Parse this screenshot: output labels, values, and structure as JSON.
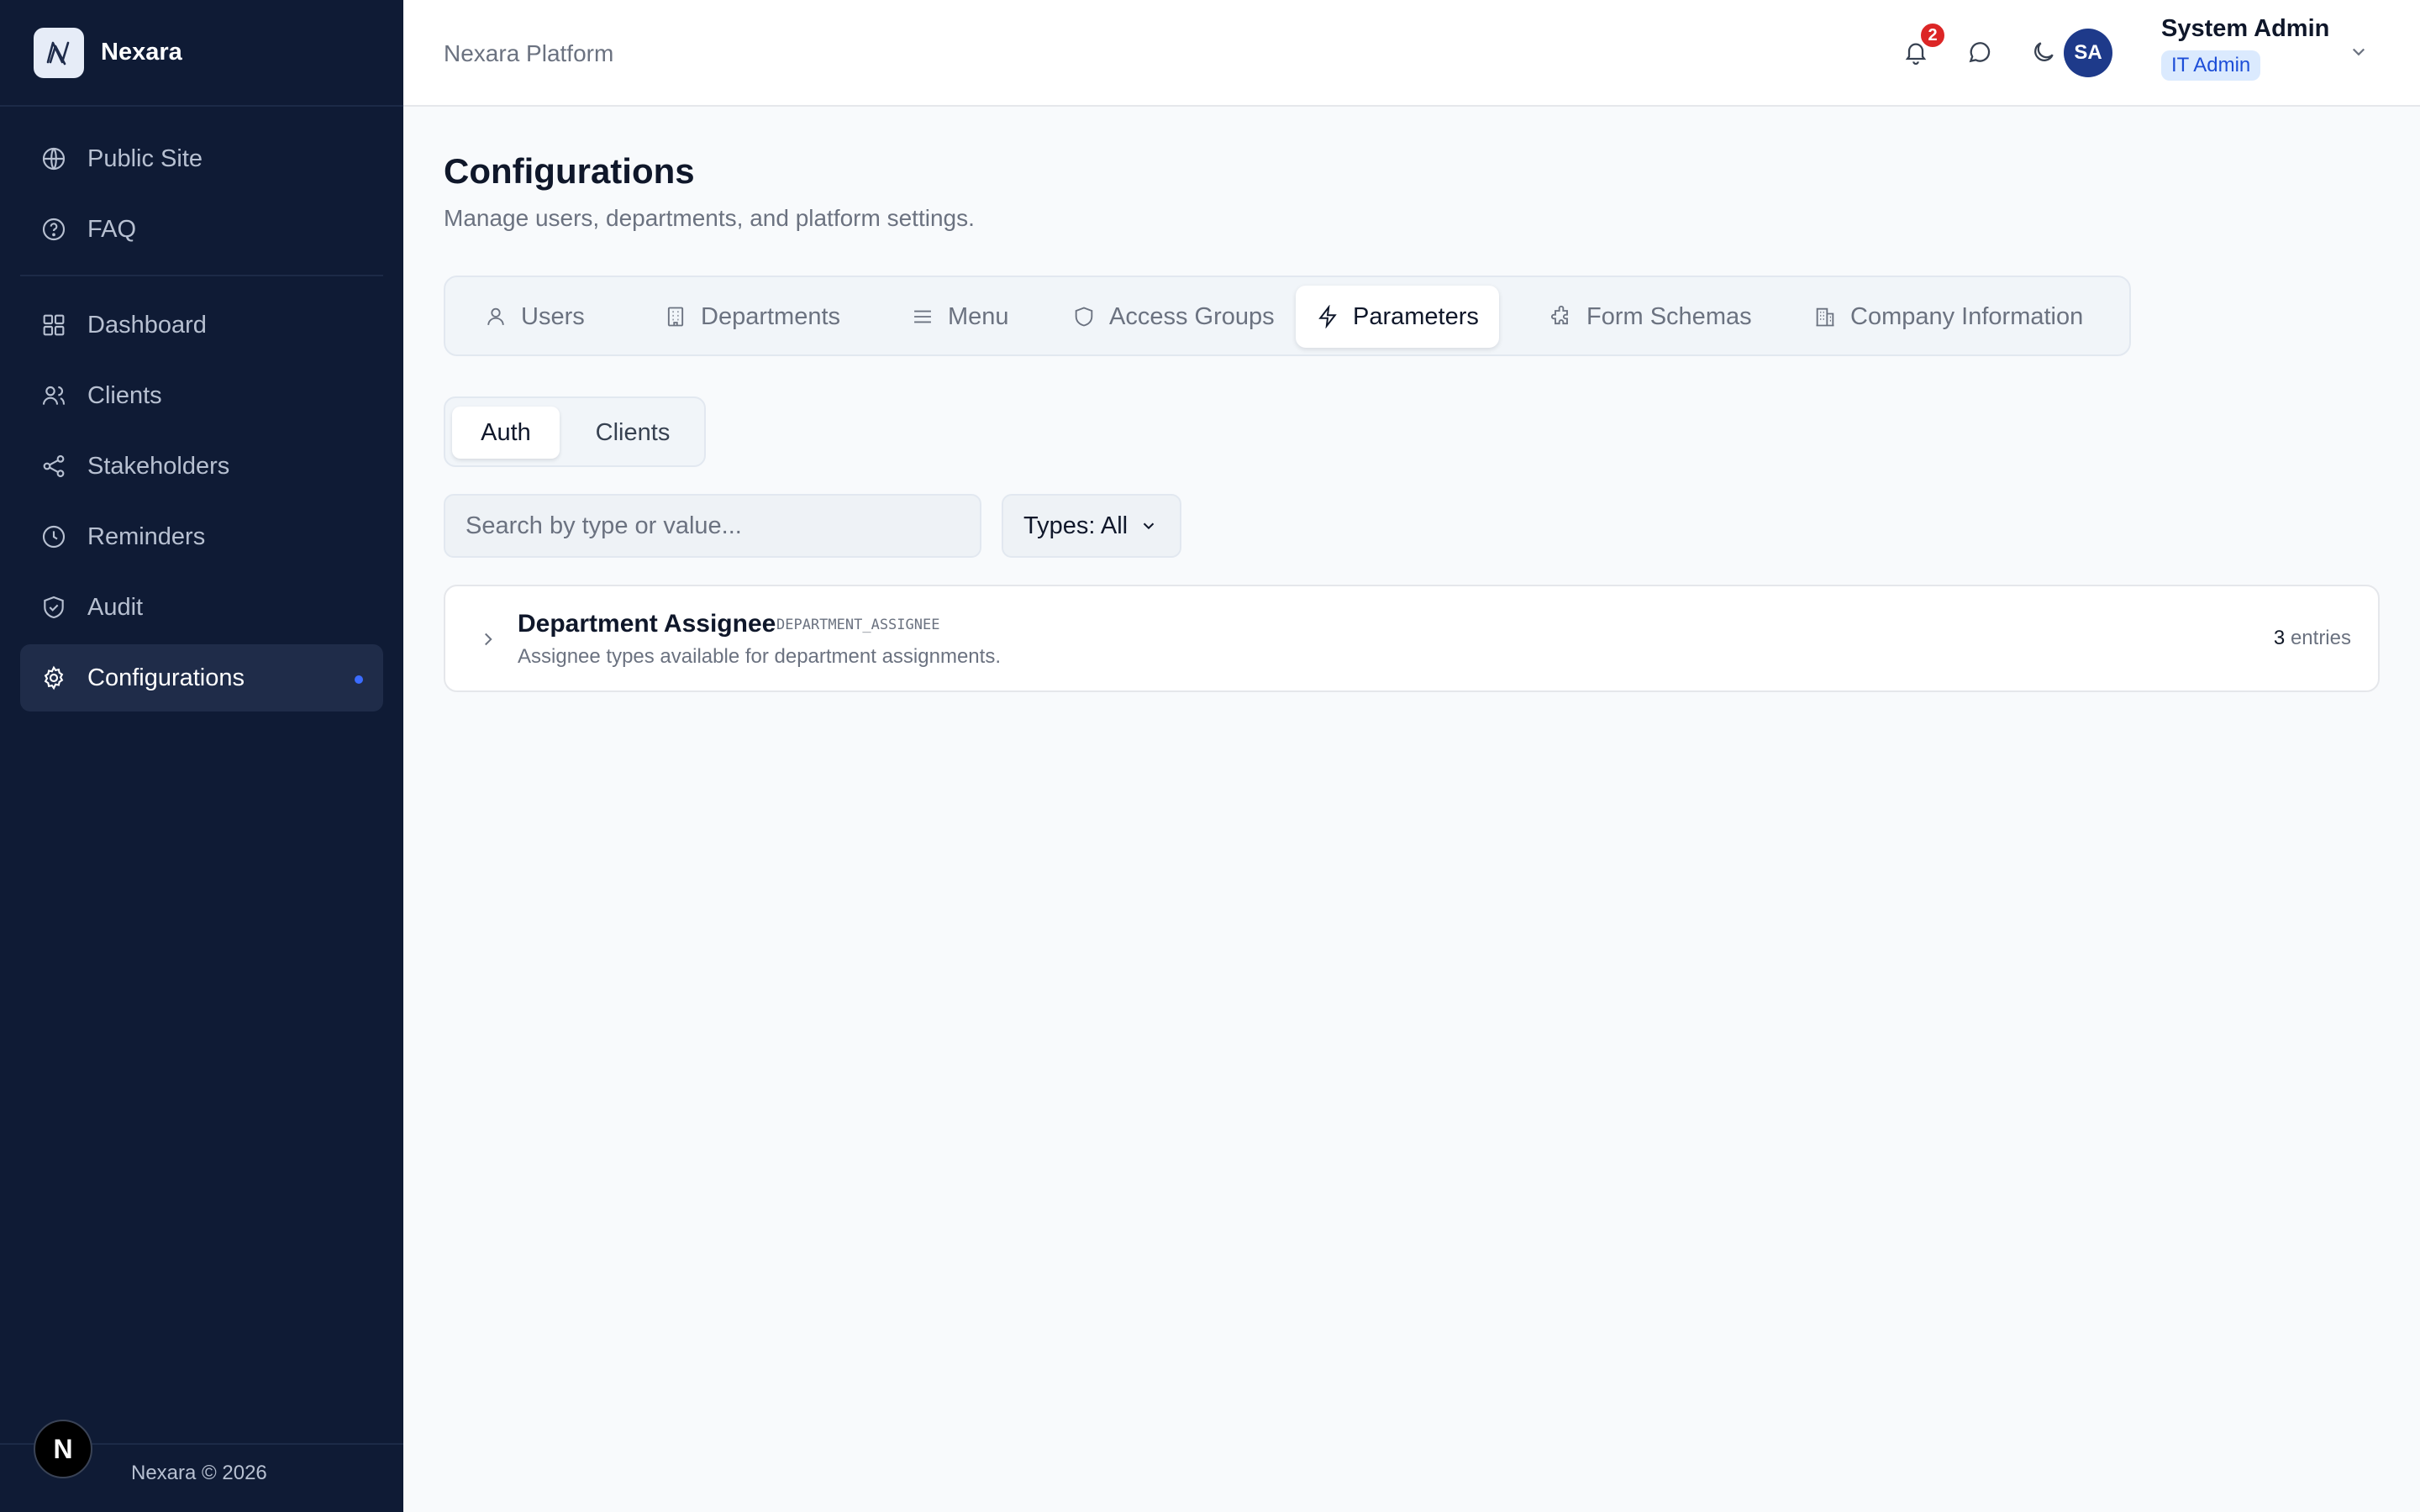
{
  "brand": {
    "name": "Nexara"
  },
  "sidebar": {
    "top_items": [
      {
        "label": "Public Site",
        "icon": "globe-icon"
      },
      {
        "label": "FAQ",
        "icon": "help-circle-icon"
      }
    ],
    "items": [
      {
        "label": "Dashboard",
        "icon": "grid-icon"
      },
      {
        "label": "Clients",
        "icon": "users-icon"
      },
      {
        "label": "Stakeholders",
        "icon": "share-icon"
      },
      {
        "label": "Reminders",
        "icon": "clock-icon"
      },
      {
        "label": "Audit",
        "icon": "shield-check-icon"
      },
      {
        "label": "Configurations",
        "icon": "gear-icon",
        "active": true
      }
    ],
    "footer": "Nexara © 2026",
    "badge": "N"
  },
  "header": {
    "breadcrumb": "Nexara Platform",
    "notification_count": "2",
    "user": {
      "initials": "SA",
      "name": "System Admin",
      "role": "IT Admin"
    }
  },
  "page": {
    "title": "Configurations",
    "subtitle": "Manage users, departments, and platform settings."
  },
  "tabs": [
    {
      "label": "Users",
      "icon": "user-icon"
    },
    {
      "label": "Departments",
      "icon": "building-icon"
    },
    {
      "label": "Menu",
      "icon": "menu-icon"
    },
    {
      "label": "Access Groups",
      "icon": "shield-icon"
    },
    {
      "label": "Parameters",
      "icon": "zap-icon",
      "active": true
    },
    {
      "label": "Form Schemas",
      "icon": "puzzle-icon"
    },
    {
      "label": "Company Information",
      "icon": "building-2-icon"
    }
  ],
  "subtabs": [
    {
      "label": "Auth",
      "active": true
    },
    {
      "label": "Clients"
    }
  ],
  "search": {
    "placeholder": "Search by type or value..."
  },
  "filter": {
    "label": "Types: All"
  },
  "parameters": [
    {
      "name": "Department Assignee",
      "code": "DEPARTMENT_ASSIGNEE",
      "description": "Assignee types available for department assignments.",
      "count": "3",
      "count_label": "entries"
    }
  ],
  "colors": {
    "sidebar_bg": "#0f1b35",
    "accent": "#3b6cff",
    "notification": "#dc2626",
    "avatar": "#1e3a8a"
  }
}
